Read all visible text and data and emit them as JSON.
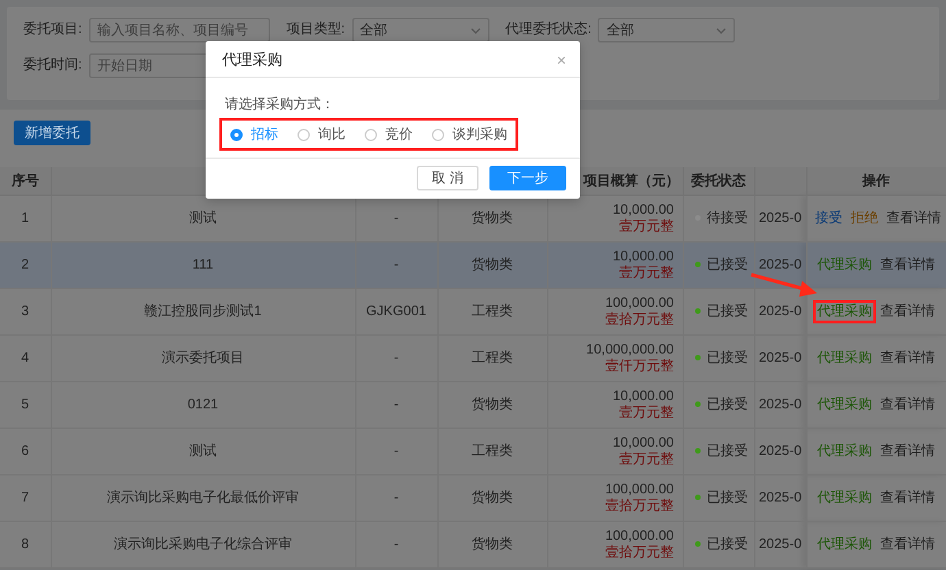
{
  "filters": [
    {
      "label": "委托项目:",
      "kind": "input",
      "placeholder": "输入项目名称、项目编号"
    },
    {
      "label": "项目类型:",
      "kind": "select",
      "value": "全部"
    },
    {
      "label": "代理委托状态:",
      "kind": "select",
      "value": "全部"
    },
    {
      "label": "委托时间:",
      "kind": "input",
      "placeholder": "开始日期"
    }
  ],
  "new_button": "新增委托",
  "table": {
    "headers": {
      "index": "序号",
      "amount": "项目概算（元）",
      "status": "委托状态",
      "actions": "操作"
    },
    "rows": [
      {
        "index": "1",
        "name": "测试",
        "code": "-",
        "type": "货物类",
        "amount": "10,000.00",
        "amount_words": "壹万元整",
        "status": "待接受",
        "color": "#8c8c8c",
        "date": "2025-0",
        "selected": false,
        "actions": [
          {
            "kind": "accept",
            "label": "接受",
            "highlighted": false
          },
          {
            "kind": "reject",
            "label": "拒绝",
            "highlighted": false
          },
          {
            "kind": "detail",
            "label": "查看详情",
            "highlighted": false
          }
        ]
      },
      {
        "index": "2",
        "name": "111",
        "code": "-",
        "type": "货物类",
        "amount": "10,000.00",
        "amount_words": "壹万元整",
        "status": "已接受",
        "color": "#3f9a1a",
        "date": "2025-0",
        "selected": true,
        "actions": [
          {
            "kind": "procure",
            "label": "代理采购",
            "highlighted": false
          },
          {
            "kind": "detail",
            "label": "查看详情",
            "highlighted": false
          }
        ]
      },
      {
        "index": "3",
        "name": "赣江控股同步测试1",
        "code": "GJKG001",
        "type": "工程类",
        "amount": "100,000.00",
        "amount_words": "壹拾万元整",
        "status": "已接受",
        "color": "#3f9a1a",
        "date": "2025-0",
        "selected": false,
        "actions": [
          {
            "kind": "procure",
            "label": "代理采购",
            "highlighted": true
          },
          {
            "kind": "detail",
            "label": "查看详情",
            "highlighted": false
          }
        ]
      },
      {
        "index": "4",
        "name": "演示委托项目",
        "code": "-",
        "type": "工程类",
        "amount": "10,000,000.00",
        "amount_words": "壹仟万元整",
        "status": "已接受",
        "color": "#3f9a1a",
        "date": "2025-0",
        "selected": false,
        "actions": [
          {
            "kind": "procure",
            "label": "代理采购",
            "highlighted": false
          },
          {
            "kind": "detail",
            "label": "查看详情",
            "highlighted": false
          }
        ]
      },
      {
        "index": "5",
        "name": "0121",
        "code": "-",
        "type": "货物类",
        "amount": "10,000.00",
        "amount_words": "壹万元整",
        "status": "已接受",
        "color": "#3f9a1a",
        "date": "2025-0",
        "selected": false,
        "actions": [
          {
            "kind": "procure",
            "label": "代理采购",
            "highlighted": false
          },
          {
            "kind": "detail",
            "label": "查看详情",
            "highlighted": false
          }
        ]
      },
      {
        "index": "6",
        "name": "测试",
        "code": "-",
        "type": "工程类",
        "amount": "10,000.00",
        "amount_words": "壹万元整",
        "status": "已接受",
        "color": "#3f9a1a",
        "date": "2025-0",
        "selected": false,
        "actions": [
          {
            "kind": "procure",
            "label": "代理采购",
            "highlighted": false
          },
          {
            "kind": "detail",
            "label": "查看详情",
            "highlighted": false
          }
        ]
      },
      {
        "index": "7",
        "name": "演示询比采购电子化最低价评审",
        "code": "-",
        "type": "货物类",
        "amount": "100,000.00",
        "amount_words": "壹拾万元整",
        "status": "已接受",
        "color": "#3f9a1a",
        "date": "2025-0",
        "selected": false,
        "actions": [
          {
            "kind": "procure",
            "label": "代理采购",
            "highlighted": false
          },
          {
            "kind": "detail",
            "label": "查看详情",
            "highlighted": false
          }
        ]
      },
      {
        "index": "8",
        "name": "演示询比采购电子化综合评审",
        "code": "-",
        "type": "货物类",
        "amount": "100,000.00",
        "amount_words": "壹拾万元整",
        "status": "已接受",
        "color": "#3f9a1a",
        "date": "2025-0",
        "selected": false,
        "actions": [
          {
            "kind": "procure",
            "label": "代理采购",
            "highlighted": false
          },
          {
            "kind": "detail",
            "label": "查看详情",
            "highlighted": false
          }
        ]
      }
    ]
  },
  "dialog": {
    "title": "代理采购",
    "close": "×",
    "prompt": "请选择采购方式：",
    "options_highlighted": true,
    "options": [
      {
        "label": "招标",
        "selected": true
      },
      {
        "label": "询比",
        "selected": false
      },
      {
        "label": "竞价",
        "selected": false
      },
      {
        "label": "谈判采购",
        "selected": false
      }
    ],
    "buttons": [
      {
        "label": "取 消",
        "primary": false
      },
      {
        "label": "下一步",
        "primary": true
      }
    ]
  }
}
